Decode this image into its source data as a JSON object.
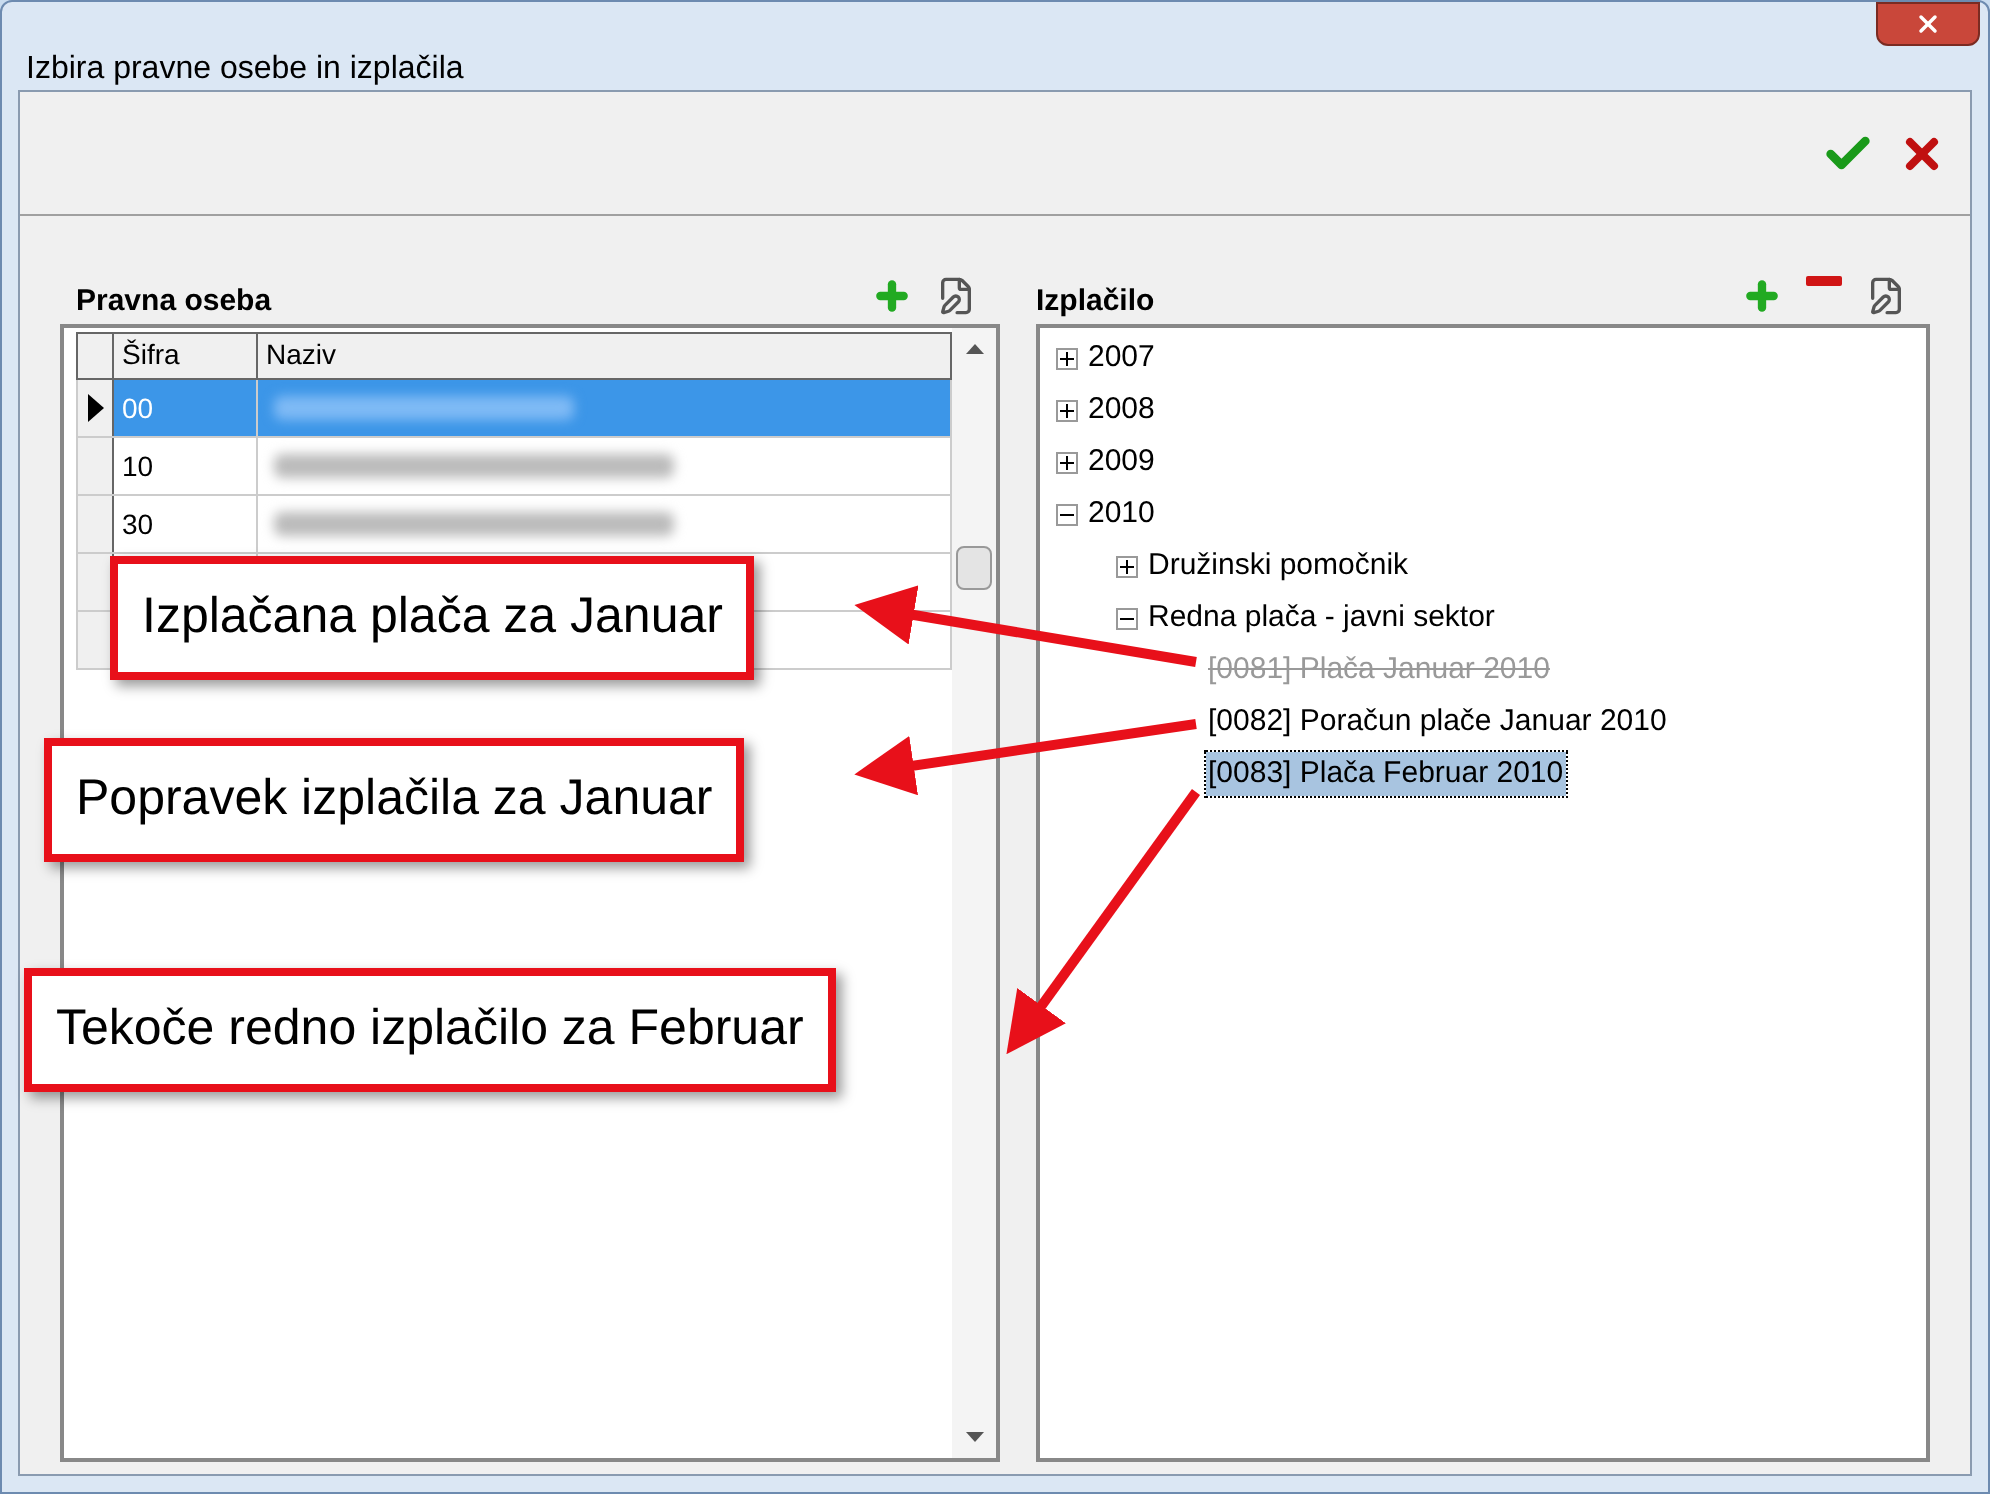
{
  "window": {
    "title": "Izbira pravne osebe in izplačila"
  },
  "left_panel": {
    "title": "Pravna oseba",
    "table": {
      "columns": [
        "Šifra",
        "Naziv"
      ],
      "rows": [
        {
          "code": "00",
          "selected": true
        },
        {
          "code": "10",
          "selected": false
        },
        {
          "code": "30",
          "selected": false
        },
        {
          "code": "",
          "selected": false
        },
        {
          "code": "",
          "selected": false
        }
      ]
    }
  },
  "right_panel": {
    "title": "Izplačilo",
    "tree": [
      {
        "label": "2007",
        "expanded": false,
        "selected": false
      },
      {
        "label": "2008",
        "expanded": false,
        "selected": false
      },
      {
        "label": "2009",
        "expanded": false,
        "selected": false
      },
      {
        "label": "2010",
        "expanded": true,
        "selected": false,
        "children": [
          {
            "label": "Družinski pomočnik",
            "expanded": false,
            "selected": false
          },
          {
            "label": "Redna plača - javni sektor",
            "expanded": true,
            "selected": false,
            "children": [
              {
                "label": "[0081] Plača Januar 2010",
                "cancelled": true,
                "selected": false
              },
              {
                "label": "[0082] Poračun plače Januar 2010",
                "cancelled": false,
                "selected": false
              },
              {
                "label": "[0083] Plača Februar 2010",
                "cancelled": false,
                "selected": true
              }
            ]
          }
        ]
      }
    ]
  },
  "callouts": [
    {
      "text": "Izplačana plača za Januar"
    },
    {
      "text": "Popravek izplačila za Januar"
    },
    {
      "text": "Tekoče redno izplačilo za Februar"
    }
  ]
}
